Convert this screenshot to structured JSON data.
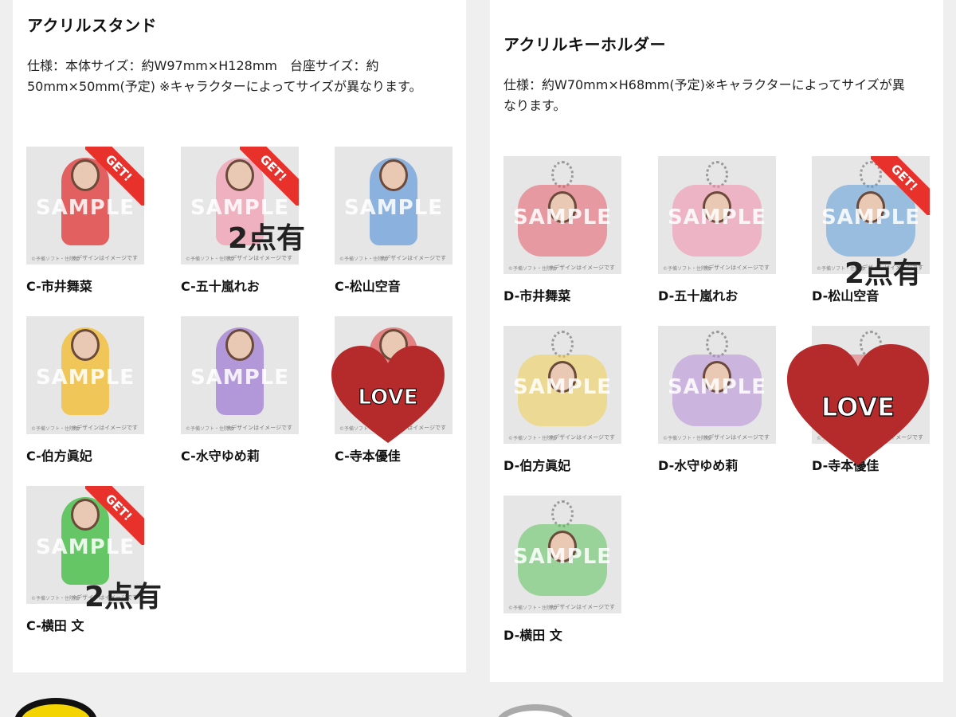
{
  "sections": {
    "acrylic_stand": {
      "title": "アクリルスタンド",
      "spec_line1": "仕様：本体サイズ：約W97mm×H128mm　台座サイズ：約",
      "spec_line2": "50mm×50mm(予定) ※キャラクターによってサイズが異なります。",
      "items": [
        {
          "label": "C-市井舞菜",
          "get": true,
          "accent": "#e04848"
        },
        {
          "label": "C-五十嵐れお",
          "get": true,
          "accent": "#f0a6b8"
        },
        {
          "label": "C-松山空音",
          "get": false,
          "accent": "#7aa8dc"
        },
        {
          "label": "C-伯方眞妃",
          "get": false,
          "accent": "#f2c040"
        },
        {
          "label": "C-水守ゆめ莉",
          "get": false,
          "accent": "#a98ad6"
        },
        {
          "label": "C-寺本優佳",
          "get": false,
          "accent": "#e07070"
        },
        {
          "label": "C-横田 文",
          "get": true,
          "accent": "#4cbf4c"
        }
      ]
    },
    "acrylic_keyholder": {
      "title": "アクリルキーホルダー",
      "spec_line1": "仕様：約W70mm×H68mm(予定)※キャラクターによってサイズが異",
      "spec_line2": "なります。",
      "items": [
        {
          "label": "D-市井舞菜",
          "get": false,
          "accent": "#e85a6a"
        },
        {
          "label": "D-五十嵐れお",
          "get": false,
          "accent": "#f08aa8"
        },
        {
          "label": "D-松山空音",
          "get": true,
          "accent": "#5a9ad8"
        },
        {
          "label": "D-伯方眞妃",
          "get": false,
          "accent": "#f0d050"
        },
        {
          "label": "D-水守ゆめ莉",
          "get": false,
          "accent": "#b48ad6"
        },
        {
          "label": "D-寺本優佳",
          "get": false,
          "accent": "#e06a6a"
        },
        {
          "label": "D-横田 文",
          "get": false,
          "accent": "#5ac25a"
        }
      ]
    }
  },
  "overlays": {
    "get_text": "GET!",
    "sample_text": "SAMPLE",
    "image_note": "※デザインはイメージです",
    "image_credit": "©予備ソフト・住院版",
    "count_note": "2点有",
    "love_text": "LOVE",
    "love_color": "#b52a2a",
    "get_color": "#e8312b"
  }
}
